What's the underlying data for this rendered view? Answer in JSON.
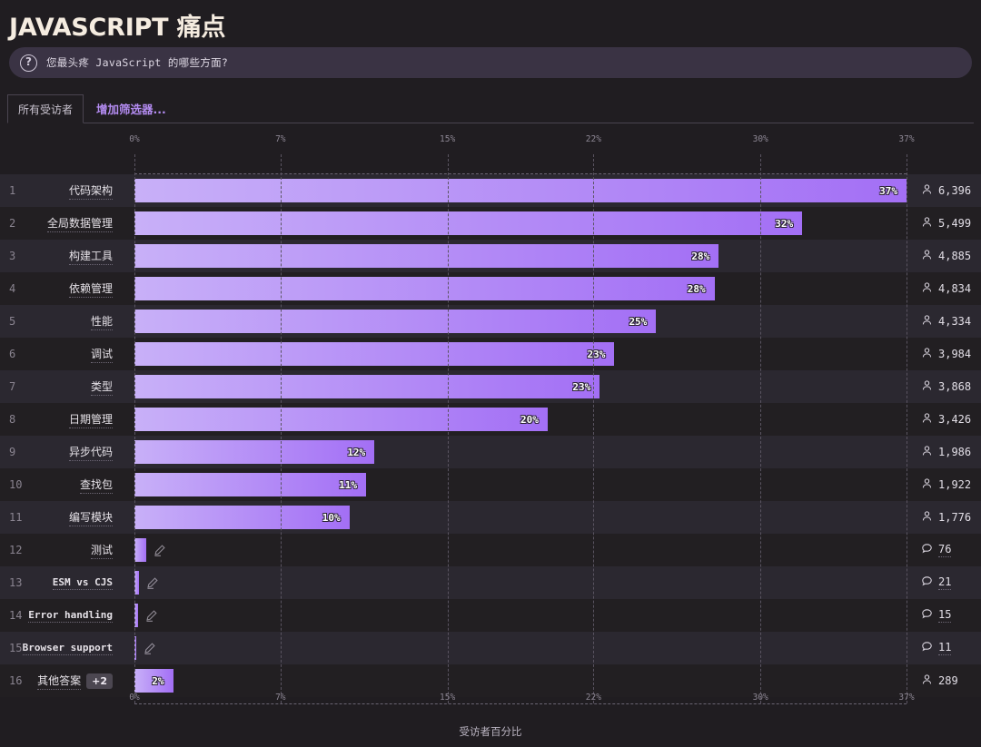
{
  "header": {
    "title": "JAVASCRIPT 痛点",
    "help_icon": "question-mark-circle-icon",
    "question": "您最头疼 JavaScript 的哪些方面?"
  },
  "tabs": {
    "active_tab": "所有受访者",
    "add_filter": "增加筛选器..."
  },
  "colors": {
    "bar_start": "#c8b0f8",
    "bar_end": "#a36ff5",
    "accent": "#b48cf2",
    "row_odd": "#2b2830",
    "row_even": "#221f22",
    "page_bg": "#201d21",
    "question_bar": "#3a3344"
  },
  "chart_data": {
    "type": "bar",
    "orientation": "horizontal",
    "title": "JAVASCRIPT 痛点",
    "xlabel": "受访者百分比",
    "ylabel": "",
    "xlim": [
      0,
      37
    ],
    "grid": true,
    "tick_labels": [
      "0%",
      "7%",
      "15%",
      "22%",
      "30%",
      "37%"
    ],
    "tick_values": [
      0,
      7,
      15,
      22,
      30,
      37
    ],
    "categories": [
      "代码架构",
      "全局数据管理",
      "构建工具",
      "依赖管理",
      "性能",
      "调试",
      "类型",
      "日期管理",
      "异步代码",
      "查找包",
      "编写模块",
      "测试",
      "ESM vs CJS",
      "Error handling",
      "Browser support",
      "其他答案"
    ],
    "values": [
      37,
      32,
      28,
      28,
      25,
      23,
      23,
      20,
      12,
      11,
      10,
      0.6,
      0.2,
      0.15,
      0.1,
      2
    ],
    "value_labels": [
      "37%",
      "32%",
      "28%",
      "28%",
      "25%",
      "23%",
      "23%",
      "20%",
      "12%",
      "11%",
      "10%",
      "",
      "",
      "",
      "",
      "2%"
    ],
    "counts": [
      "6,396",
      "5,499",
      "4,885",
      "4,834",
      "4,334",
      "3,984",
      "3,868",
      "3,426",
      "1,986",
      "1,922",
      "1,776",
      "76",
      "21",
      "15",
      "11",
      "289"
    ]
  },
  "rows": [
    {
      "rank": "1",
      "label": "代码架构",
      "mono": false,
      "pct_label": "37%",
      "bar_pct": 37,
      "count": "6,396",
      "count_icon": "person-icon",
      "pencil": false,
      "badge": "",
      "count_dotted": false
    },
    {
      "rank": "2",
      "label": "全局数据管理",
      "mono": false,
      "pct_label": "32%",
      "bar_pct": 32,
      "count": "5,499",
      "count_icon": "person-icon",
      "pencil": false,
      "badge": "",
      "count_dotted": false
    },
    {
      "rank": "3",
      "label": "构建工具",
      "mono": false,
      "pct_label": "28%",
      "bar_pct": 28,
      "count": "4,885",
      "count_icon": "person-icon",
      "pencil": false,
      "badge": "",
      "count_dotted": false
    },
    {
      "rank": "4",
      "label": "依赖管理",
      "mono": false,
      "pct_label": "28%",
      "bar_pct": 27.8,
      "count": "4,834",
      "count_icon": "person-icon",
      "pencil": false,
      "badge": "",
      "count_dotted": false
    },
    {
      "rank": "5",
      "label": "性能",
      "mono": false,
      "pct_label": "25%",
      "bar_pct": 25,
      "count": "4,334",
      "count_icon": "person-icon",
      "pencil": false,
      "badge": "",
      "count_dotted": false
    },
    {
      "rank": "6",
      "label": "调试",
      "mono": false,
      "pct_label": "23%",
      "bar_pct": 23,
      "count": "3,984",
      "count_icon": "person-icon",
      "pencil": false,
      "badge": "",
      "count_dotted": false
    },
    {
      "rank": "7",
      "label": "类型",
      "mono": false,
      "pct_label": "23%",
      "bar_pct": 22.3,
      "count": "3,868",
      "count_icon": "person-icon",
      "pencil": false,
      "badge": "",
      "count_dotted": false
    },
    {
      "rank": "8",
      "label": "日期管理",
      "mono": false,
      "pct_label": "20%",
      "bar_pct": 19.8,
      "count": "3,426",
      "count_icon": "person-icon",
      "pencil": false,
      "badge": "",
      "count_dotted": false
    },
    {
      "rank": "9",
      "label": "异步代码",
      "mono": false,
      "pct_label": "12%",
      "bar_pct": 11.5,
      "count": "1,986",
      "count_icon": "person-icon",
      "pencil": false,
      "badge": "",
      "count_dotted": false
    },
    {
      "rank": "10",
      "label": "查找包",
      "mono": false,
      "pct_label": "11%",
      "bar_pct": 11.1,
      "count": "1,922",
      "count_icon": "person-icon",
      "pencil": false,
      "badge": "",
      "count_dotted": false
    },
    {
      "rank": "11",
      "label": "编写模块",
      "mono": false,
      "pct_label": "10%",
      "bar_pct": 10.3,
      "count": "1,776",
      "count_icon": "person-icon",
      "pencil": false,
      "badge": "",
      "count_dotted": false
    },
    {
      "rank": "12",
      "label": "测试",
      "mono": false,
      "pct_label": "",
      "bar_pct": 0.55,
      "count": "76",
      "count_icon": "comment-icon",
      "pencil": true,
      "badge": "",
      "count_dotted": true
    },
    {
      "rank": "13",
      "label": "ESM vs CJS",
      "mono": true,
      "pct_label": "",
      "bar_pct": 0.2,
      "count": "21",
      "count_icon": "comment-icon",
      "pencil": true,
      "badge": "",
      "count_dotted": true
    },
    {
      "rank": "14",
      "label": "Error handling",
      "mono": true,
      "pct_label": "",
      "bar_pct": 0.16,
      "count": "15",
      "count_icon": "comment-icon",
      "pencil": true,
      "badge": "",
      "count_dotted": true
    },
    {
      "rank": "15",
      "label": "Browser support",
      "mono": true,
      "pct_label": "",
      "bar_pct": 0.1,
      "count": "11",
      "count_icon": "comment-icon",
      "pencil": true,
      "badge": "",
      "count_dotted": true
    },
    {
      "rank": "16",
      "label": "其他答案",
      "mono": false,
      "pct_label": "2%",
      "bar_pct": 1.85,
      "count": "289",
      "count_icon": "person-icon",
      "pencil": false,
      "badge": "+2",
      "count_dotted": false
    }
  ],
  "footer": {
    "xlabel": "受访者百分比"
  }
}
